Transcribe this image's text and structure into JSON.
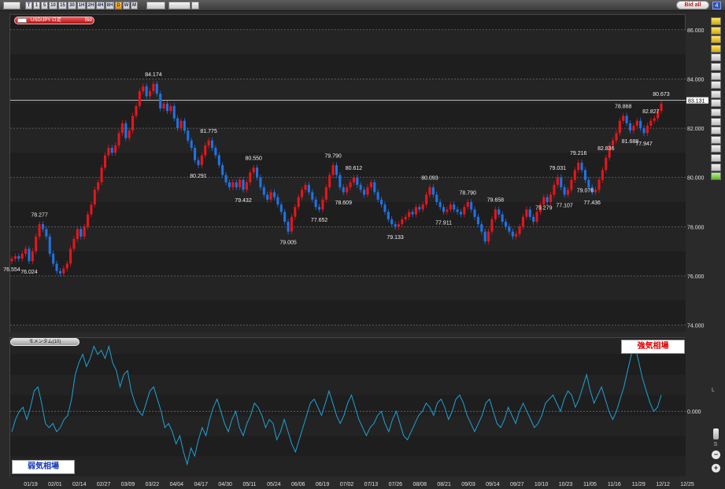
{
  "toolbar": {
    "timeframes": [
      {
        "label": "T",
        "active": false
      },
      {
        "label": "1",
        "active": false
      },
      {
        "label": "5",
        "active": false
      },
      {
        "label": "10",
        "active": false
      },
      {
        "label": "15",
        "active": false
      },
      {
        "label": "30",
        "active": false
      },
      {
        "label": "1H",
        "active": false
      },
      {
        "label": "2H",
        "active": false
      },
      {
        "label": "4H",
        "active": false
      },
      {
        "label": "8H",
        "active": false
      },
      {
        "label": "D",
        "active": true
      },
      {
        "label": "W",
        "active": false
      },
      {
        "label": "M",
        "active": false
      }
    ],
    "bid_all_label": "Bid all",
    "window_number": "4"
  },
  "main_chart": {
    "pair_label": "USD/JPY ロ足",
    "price_type": "Bid",
    "current_price": "83.131"
  },
  "momentum_panel": {
    "label": "モメンタム(10)",
    "strong_label": "強気相場",
    "weak_label": "弱気相場",
    "axis_s": "S",
    "axis_l": "L"
  },
  "sidebar": {
    "plus": "+",
    "minus": "−"
  },
  "chart_data": [
    {
      "type": "candlestick",
      "title": "",
      "ylim": [
        73.7,
        86.6
      ],
      "y_ticks": [
        "86.000",
        "84.000",
        "82.000",
        "80.000",
        "78.000",
        "76.000",
        "74.000"
      ],
      "y_tick_values": [
        86,
        84,
        82,
        80,
        78,
        76,
        74
      ],
      "x_tick_labels": [
        "01/19",
        "02/01",
        "02/14",
        "02/27",
        "03/09",
        "03/22",
        "04/04",
        "04/17",
        "04/30",
        "05/11",
        "05/24",
        "06/06",
        "06/19",
        "07/02",
        "07/13",
        "07/26",
        "08/08",
        "08/21",
        "09/03",
        "09/14",
        "09/27",
        "10/10",
        "10/23",
        "11/05",
        "11/16",
        "11/29",
        "12/12",
        "12/25"
      ],
      "up_color": "#e8151b",
      "down_color": "#1f73e6",
      "current_price_line": 83.131,
      "series": [
        {
          "values": [
            76.7,
            76.8,
            76.7,
            76.9,
            77.1,
            76.6,
            77.0,
            77.6,
            78.1,
            77.9,
            77.6,
            76.9,
            76.5,
            76.2,
            76.1,
            76.3,
            76.5,
            77.1,
            77.5,
            77.9,
            77.6,
            78.0,
            78.5,
            78.9,
            79.5,
            79.8,
            80.4,
            80.9,
            81.2,
            81.0,
            81.3,
            81.8,
            82.2,
            81.6,
            81.9,
            82.5,
            82.9,
            83.5,
            83.7,
            83.3,
            83.5,
            83.8,
            83.4,
            82.8,
            83.0,
            82.7,
            82.9,
            82.4,
            82.0,
            82.3,
            81.9,
            81.5,
            81.2,
            80.7,
            80.5,
            80.9,
            81.3,
            81.5,
            81.2,
            80.9,
            80.5,
            80.1,
            79.8,
            79.6,
            79.8,
            79.6,
            79.9,
            79.5,
            79.8,
            80.2,
            80.4,
            80.0,
            79.6,
            79.3,
            79.1,
            79.4,
            79.2,
            78.9,
            78.6,
            78.2,
            77.8,
            78.4,
            78.8,
            79.2,
            79.5,
            79.7,
            79.4,
            79.1,
            78.8,
            78.7,
            79.1,
            79.6,
            80.1,
            80.5,
            80.1,
            79.6,
            79.4,
            79.6,
            79.8,
            80.0,
            79.7,
            79.5,
            79.3,
            79.6,
            79.8,
            79.4,
            79.1,
            78.9,
            78.6,
            78.3,
            78.1,
            78.0,
            78.1,
            78.3,
            78.4,
            78.6,
            78.5,
            78.8,
            78.7,
            78.9,
            79.3,
            79.6,
            79.3,
            79.0,
            78.8,
            78.6,
            78.7,
            78.9,
            78.7,
            78.6,
            78.5,
            78.8,
            79.0,
            78.7,
            78.4,
            78.1,
            77.8,
            77.4,
            77.8,
            78.3,
            78.7,
            78.5,
            78.2,
            78.0,
            77.8,
            77.6,
            77.7,
            78.0,
            78.4,
            78.7,
            78.4,
            78.2,
            78.6,
            78.9,
            79.2,
            79.0,
            79.3,
            79.7,
            80.0,
            79.6,
            79.3,
            79.5,
            79.9,
            80.3,
            80.6,
            80.3,
            79.9,
            79.6,
            79.4,
            79.5,
            79.9,
            80.3,
            80.8,
            81.3,
            81.5,
            81.8,
            82.3,
            82.5,
            82.2,
            81.9,
            82.1,
            82.3,
            82.0,
            81.8,
            82.1,
            82.3,
            82.4,
            82.7,
            83.0
          ]
        }
      ],
      "annotations": [
        {
          "label": "76.554",
          "kind": "low"
        },
        {
          "label": "76.024",
          "kind": "low"
        },
        {
          "label": "78.277",
          "kind": "high"
        },
        {
          "label": "84.174",
          "kind": "high"
        },
        {
          "label": "80.291",
          "kind": "low"
        },
        {
          "label": "81.775",
          "kind": "high"
        },
        {
          "label": "79.432",
          "kind": "low"
        },
        {
          "label": "80.550",
          "kind": "high"
        },
        {
          "label": "79.005",
          "kind": "low"
        },
        {
          "label": "77.652",
          "kind": "low"
        },
        {
          "label": "79.790",
          "kind": "high"
        },
        {
          "label": "78.609",
          "kind": "low"
        },
        {
          "label": "80.612",
          "kind": "high"
        },
        {
          "label": "79.133",
          "kind": "low"
        },
        {
          "label": "80.093",
          "kind": "high"
        },
        {
          "label": "77.911",
          "kind": "low"
        },
        {
          "label": "78.790",
          "kind": "high"
        },
        {
          "label": "79.658",
          "kind": "high"
        },
        {
          "label": "79.031",
          "kind": "high"
        },
        {
          "label": "77.107",
          "kind": "low"
        },
        {
          "label": "79.216",
          "kind": "high"
        },
        {
          "label": "77.436",
          "kind": "low"
        },
        {
          "label": "78.868",
          "kind": "high"
        },
        {
          "label": "77.947",
          "kind": "low"
        },
        {
          "label": "79.279",
          "kind": "low"
        },
        {
          "label": "80.673",
          "kind": "high"
        },
        {
          "label": "79.076",
          "kind": "low"
        },
        {
          "label": "82.836",
          "kind": "high"
        },
        {
          "label": "81.688",
          "kind": "low"
        },
        {
          "label": "82.827",
          "kind": "high"
        }
      ]
    },
    {
      "type": "line",
      "title": "",
      "ylim": [
        -1.6,
        1.8
      ],
      "y_ticks": [
        "0.000"
      ],
      "y_tick_values": [
        0
      ],
      "line_color": "#1da3d6",
      "series": [
        {
          "values": [
            -0.5,
            -0.2,
            0.0,
            0.1,
            -0.2,
            0.1,
            0.5,
            0.6,
            0.2,
            -0.3,
            -0.4,
            -0.3,
            -0.5,
            -0.4,
            -0.2,
            -0.1,
            0.3,
            0.9,
            1.2,
            1.4,
            1.1,
            1.3,
            1.6,
            1.4,
            1.5,
            1.3,
            1.6,
            1.2,
            1.0,
            0.6,
            0.9,
            1.0,
            0.5,
            0.2,
            0.0,
            -0.1,
            0.2,
            0.5,
            0.6,
            0.3,
            0.0,
            -0.4,
            -0.3,
            -0.5,
            -0.8,
            -0.6,
            -1.0,
            -1.3,
            -0.9,
            -1.1,
            -0.7,
            -0.4,
            -0.6,
            -0.2,
            0.1,
            0.3,
            0.0,
            -0.3,
            -0.5,
            -0.2,
            0.0,
            -0.4,
            -0.6,
            -0.3,
            -0.1,
            0.2,
            0.1,
            -0.1,
            -0.4,
            -0.2,
            -0.3,
            -0.7,
            -0.5,
            -0.2,
            -0.5,
            -0.8,
            -1.0,
            -0.7,
            -0.4,
            -0.1,
            0.2,
            0.3,
            0.1,
            -0.1,
            0.2,
            0.5,
            0.2,
            -0.1,
            -0.3,
            -0.1,
            0.2,
            0.4,
            0.1,
            -0.2,
            -0.4,
            -0.6,
            -0.4,
            -0.3,
            -0.1,
            0.0,
            -0.3,
            -0.5,
            -0.2,
            0.0,
            -0.3,
            -0.6,
            -0.7,
            -0.5,
            -0.3,
            -0.1,
            0.0,
            0.2,
            0.1,
            -0.1,
            0.2,
            0.3,
            0.1,
            -0.2,
            0.0,
            0.3,
            0.4,
            0.2,
            -0.1,
            -0.3,
            -0.5,
            -0.3,
            -0.1,
            0.2,
            0.3,
            0.0,
            -0.3,
            -0.4,
            -0.2,
            0.1,
            -0.1,
            -0.3,
            0.0,
            0.2,
            0.0,
            -0.2,
            -0.4,
            -0.3,
            -0.1,
            0.2,
            0.3,
            0.4,
            0.2,
            0.0,
            0.3,
            0.5,
            0.4,
            0.1,
            0.3,
            0.6,
            0.9,
            0.5,
            0.2,
            0.4,
            0.6,
            0.3,
            0.0,
            -0.2,
            0.0,
            0.3,
            0.6,
            1.0,
            1.4,
            1.6,
            1.2,
            0.8,
            0.5,
            0.2,
            0.0,
            0.1,
            0.4
          ]
        }
      ]
    }
  ]
}
